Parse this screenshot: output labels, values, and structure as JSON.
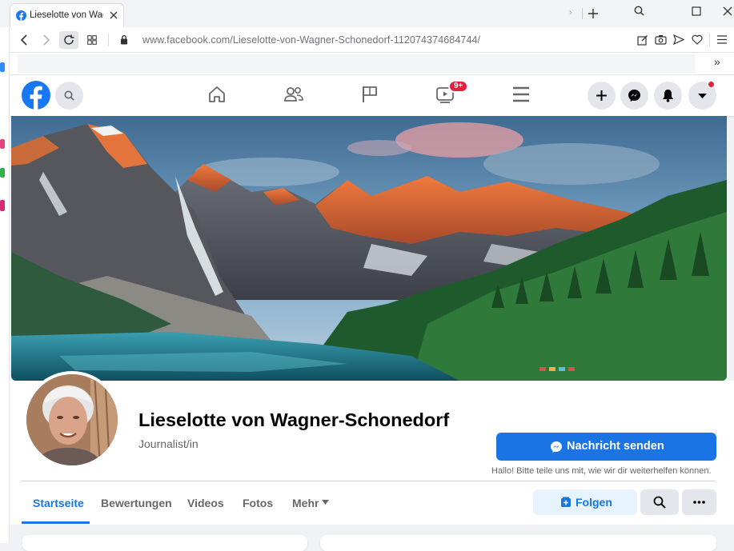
{
  "browser": {
    "tab_title": "Lieselotte von Wagner",
    "url": "www.facebook.com/Lieselotte-von-Wagner-Schonedorf-112074374684744/"
  },
  "fb_nav": {
    "watch_badge": "9+",
    "colors": {
      "brand": "#1877f2",
      "badge": "#e41e3f"
    }
  },
  "profile": {
    "name": "Lieselotte von Wagner-Schonedorf",
    "category": "Journalist/in",
    "message_button": "Nachricht senden",
    "message_hint": "Hallo! Bitte teile uns mit, wie wir dir weiterhelfen können."
  },
  "tabs": [
    {
      "label": "Startseite",
      "active": true
    },
    {
      "label": "Bewertungen"
    },
    {
      "label": "Videos"
    },
    {
      "label": "Fotos"
    },
    {
      "label": "Mehr"
    }
  ],
  "actions": {
    "follow": "Folgen"
  },
  "colors": {
    "primary": "#1b74e4",
    "primary_light": "#e7f3ff",
    "text": "#050505",
    "secondary_text": "#65676b"
  }
}
